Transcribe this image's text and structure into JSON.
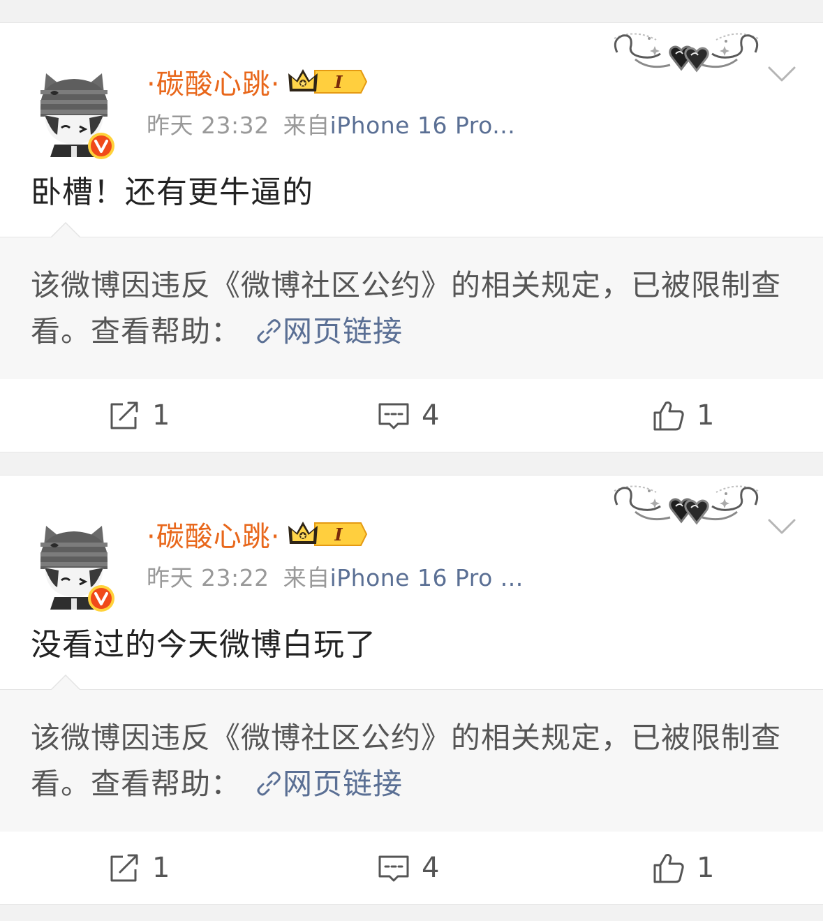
{
  "posts": [
    {
      "username": "·碳酸心跳·",
      "time": "昨天 23:32",
      "source_prefix": "来自",
      "source": "iPhone 16 Pro...",
      "content": "卧槽！还有更牛逼的",
      "notice_text": "该微博因违反《微博社区公约》的相关规定，已被限制查看。查看帮助：",
      "notice_link": "网页链接",
      "reposts": "1",
      "comments": "4",
      "likes": "1"
    },
    {
      "username": "·碳酸心跳·",
      "time": "昨天 23:22",
      "source_prefix": "来自",
      "source": "iPhone 16 Pro ...",
      "content": "没看过的今天微博白玩了",
      "notice_text": "该微博因违反《微博社区公约》的相关规定，已被限制查看。查看帮助：",
      "notice_link": "网页链接",
      "reposts": "1",
      "comments": "4",
      "likes": "1"
    }
  ],
  "badge": {
    "level_text": "I"
  },
  "colors": {
    "username": "#e8671b",
    "link": "#5a6f94",
    "meta": "#999999",
    "verified": "#f04a1a",
    "feed_background": "#f2f2f2",
    "notice_background": "#f7f7f7"
  },
  "icons": {
    "repost": "repost-icon",
    "comment": "comment-icon",
    "like": "thumbs-up-icon",
    "menu": "chevron-down-icon",
    "link": "link-icon",
    "verified": "verified-v-icon",
    "crown": "crown-icon"
  }
}
